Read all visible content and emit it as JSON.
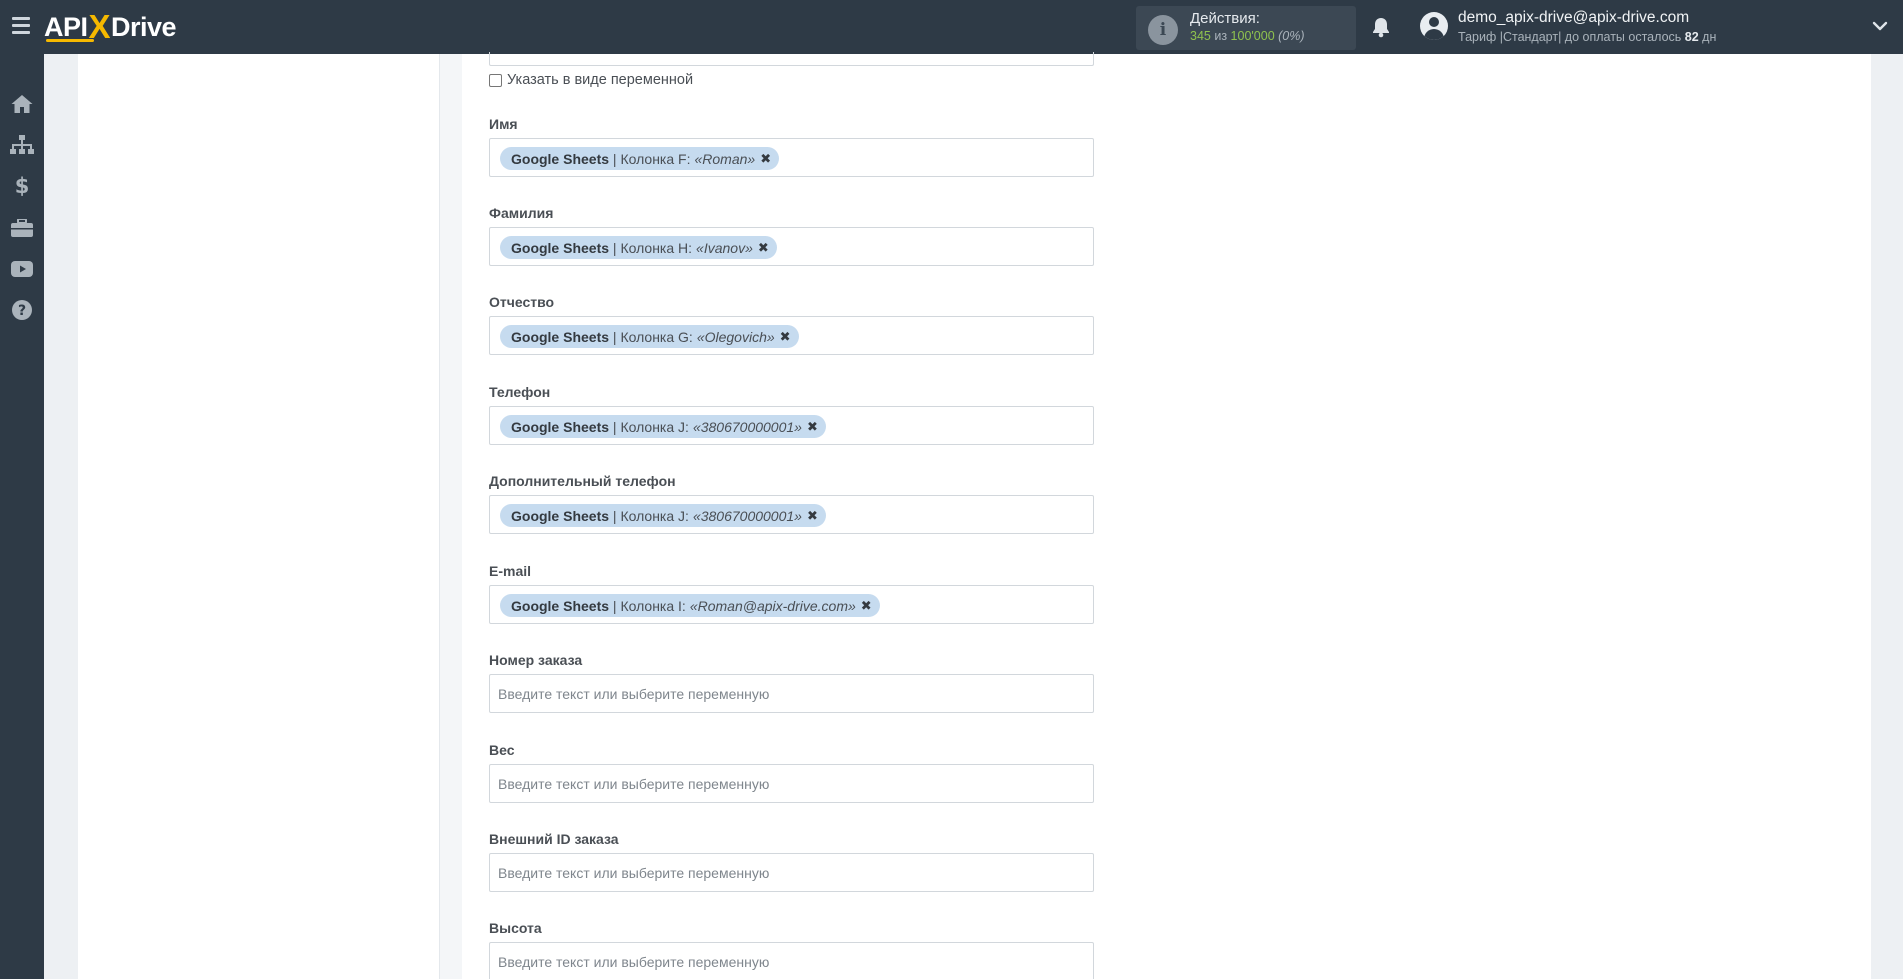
{
  "app": {
    "logo_left": "API",
    "logo_x": "X",
    "logo_right": "Drive"
  },
  "header": {
    "actions_label": "Действия:",
    "actions_used": "345",
    "actions_of": "из",
    "actions_total": "100'000",
    "actions_percent": "(0%)",
    "user_email": "demo_apix-drive@apix-drive.com",
    "plan_prefix": "Тариф |Стандарт| до оплаты осталось",
    "plan_days": "82",
    "plan_suffix": "дн"
  },
  "sidebar": {
    "items": [
      {
        "icon": "home-icon"
      },
      {
        "icon": "sitemap-icon"
      },
      {
        "icon": "dollar-icon"
      },
      {
        "icon": "briefcase-icon"
      },
      {
        "icon": "youtube-icon"
      },
      {
        "icon": "help-icon"
      }
    ]
  },
  "form": {
    "checkbox_label": "Указать в виде переменной",
    "placeholder": "Введите текст или выберите переменную",
    "fields": [
      {
        "label": "Имя",
        "tag": {
          "source": "Google Sheets",
          "column": "| Колонка F:",
          "value": "«Roman»",
          "remove": "✖"
        }
      },
      {
        "label": "Фамилия",
        "tag": {
          "source": "Google Sheets",
          "column": "| Колонка H:",
          "value": "«Ivanov»",
          "remove": "✖"
        }
      },
      {
        "label": "Отчество",
        "tag": {
          "source": "Google Sheets",
          "column": "| Колонка G:",
          "value": "«Olegovich»",
          "remove": "✖"
        }
      },
      {
        "label": "Телефон",
        "tag": {
          "source": "Google Sheets",
          "column": "| Колонка J:",
          "value": "«380670000001»",
          "remove": "✖"
        }
      },
      {
        "label": "Дополнительный телефон",
        "tag": {
          "source": "Google Sheets",
          "column": "| Колонка J:",
          "value": "«380670000001»",
          "remove": "✖"
        }
      },
      {
        "label": "E-mail",
        "tag": {
          "source": "Google Sheets",
          "column": "| Колонка I:",
          "value": "«Roman@apix-drive.com»",
          "remove": "✖"
        }
      },
      {
        "label": "Номер заказа",
        "value": ""
      },
      {
        "label": "Вес",
        "value": ""
      },
      {
        "label": "Внешний ID заказа",
        "value": ""
      },
      {
        "label": "Высота",
        "value": ""
      }
    ]
  }
}
